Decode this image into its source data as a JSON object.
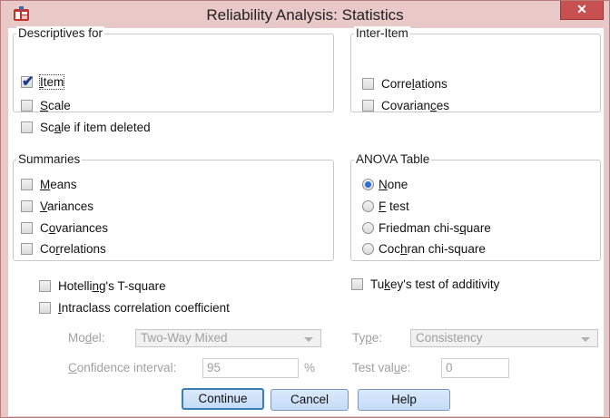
{
  "window": {
    "title": "Reliability Analysis: Statistics",
    "close_label": "✕"
  },
  "descriptives": {
    "legend": "Descriptives for",
    "item": {
      "pre": "",
      "key": "I",
      "post": "tem",
      "checked": true
    },
    "scale": {
      "pre": "",
      "key": "S",
      "post": "cale",
      "checked": false
    },
    "scale_if_deleted": {
      "pre": "Sc",
      "key": "a",
      "post": "le if item deleted",
      "checked": false
    }
  },
  "inter_item": {
    "legend": "Inter-Item",
    "correlations": {
      "pre": "Corre",
      "key": "l",
      "post": "ations",
      "checked": false
    },
    "covariances": {
      "pre": "Covarian",
      "key": "c",
      "post": "es",
      "checked": false
    }
  },
  "summaries": {
    "legend": "Summaries",
    "means": {
      "pre": "",
      "key": "M",
      "post": "eans",
      "checked": false
    },
    "variances": {
      "pre": "",
      "key": "V",
      "post": "ariances",
      "checked": false
    },
    "covariances": {
      "pre": "C",
      "key": "o",
      "post": "variances",
      "checked": false
    },
    "correlations": {
      "pre": "Co",
      "key": "r",
      "post": "relations",
      "checked": false
    }
  },
  "anova": {
    "legend": "ANOVA Table",
    "none": {
      "pre": "",
      "key": "N",
      "post": "one",
      "selected": true
    },
    "f_test": {
      "pre": "",
      "key": "F",
      "post": " test",
      "selected": false
    },
    "friedman": {
      "pre": "Friedman chi-s",
      "key": "q",
      "post": "uare",
      "selected": false
    },
    "cochran": {
      "pre": "Coc",
      "key": "h",
      "post": "ran chi-square",
      "selected": false
    }
  },
  "hotelling": {
    "pre": "Hotelli",
    "key": "n",
    "post": "g's T-square",
    "checked": false
  },
  "tukey": {
    "pre": "Tu",
    "key": "k",
    "post": "ey's test of additivity",
    "checked": false
  },
  "icc": {
    "pre": "",
    "key": "I",
    "post": "ntraclass correlation coefficient",
    "checked": false
  },
  "model": {
    "label_pre": "Mo",
    "label_key": "d",
    "label_post": "el:",
    "value": "Two-Way Mixed"
  },
  "type": {
    "label_pre": "Ty",
    "label_key": "p",
    "label_post": "e:",
    "value": "Consistency"
  },
  "confidence": {
    "label_pre": "",
    "label_key": "C",
    "label_post": "onfidence interval:",
    "value": "95",
    "unit": "%"
  },
  "test_value": {
    "label_pre": "Test val",
    "label_key": "u",
    "label_post": "e:",
    "value": "0"
  },
  "buttons": {
    "continue": "Continue",
    "cancel": "Cancel",
    "help": "Help"
  }
}
